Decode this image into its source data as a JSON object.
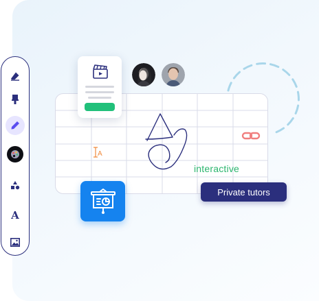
{
  "toolbar": {
    "tools": [
      {
        "icon": "eraser-icon",
        "active": false
      },
      {
        "icon": "marker-icon",
        "active": false
      },
      {
        "icon": "pen-icon",
        "active": true
      },
      {
        "icon": "palette-icon",
        "active": false
      },
      {
        "icon": "shapes-icon",
        "active": false
      },
      {
        "icon": "text-icon",
        "active": false
      },
      {
        "icon": "image-icon",
        "active": false
      }
    ],
    "text_tool_glyph": "A"
  },
  "canvas": {
    "text_cursor_label": "A",
    "interactive_label": "interactive"
  },
  "tutor_button": {
    "label": "Private tutors"
  },
  "colors": {
    "navy": "#2b2f7d",
    "green": "#21c07a",
    "blue": "#1583ef",
    "link": "#f07e7e",
    "cursor": "#f08a3c",
    "dashed": "#a9d6ea"
  }
}
